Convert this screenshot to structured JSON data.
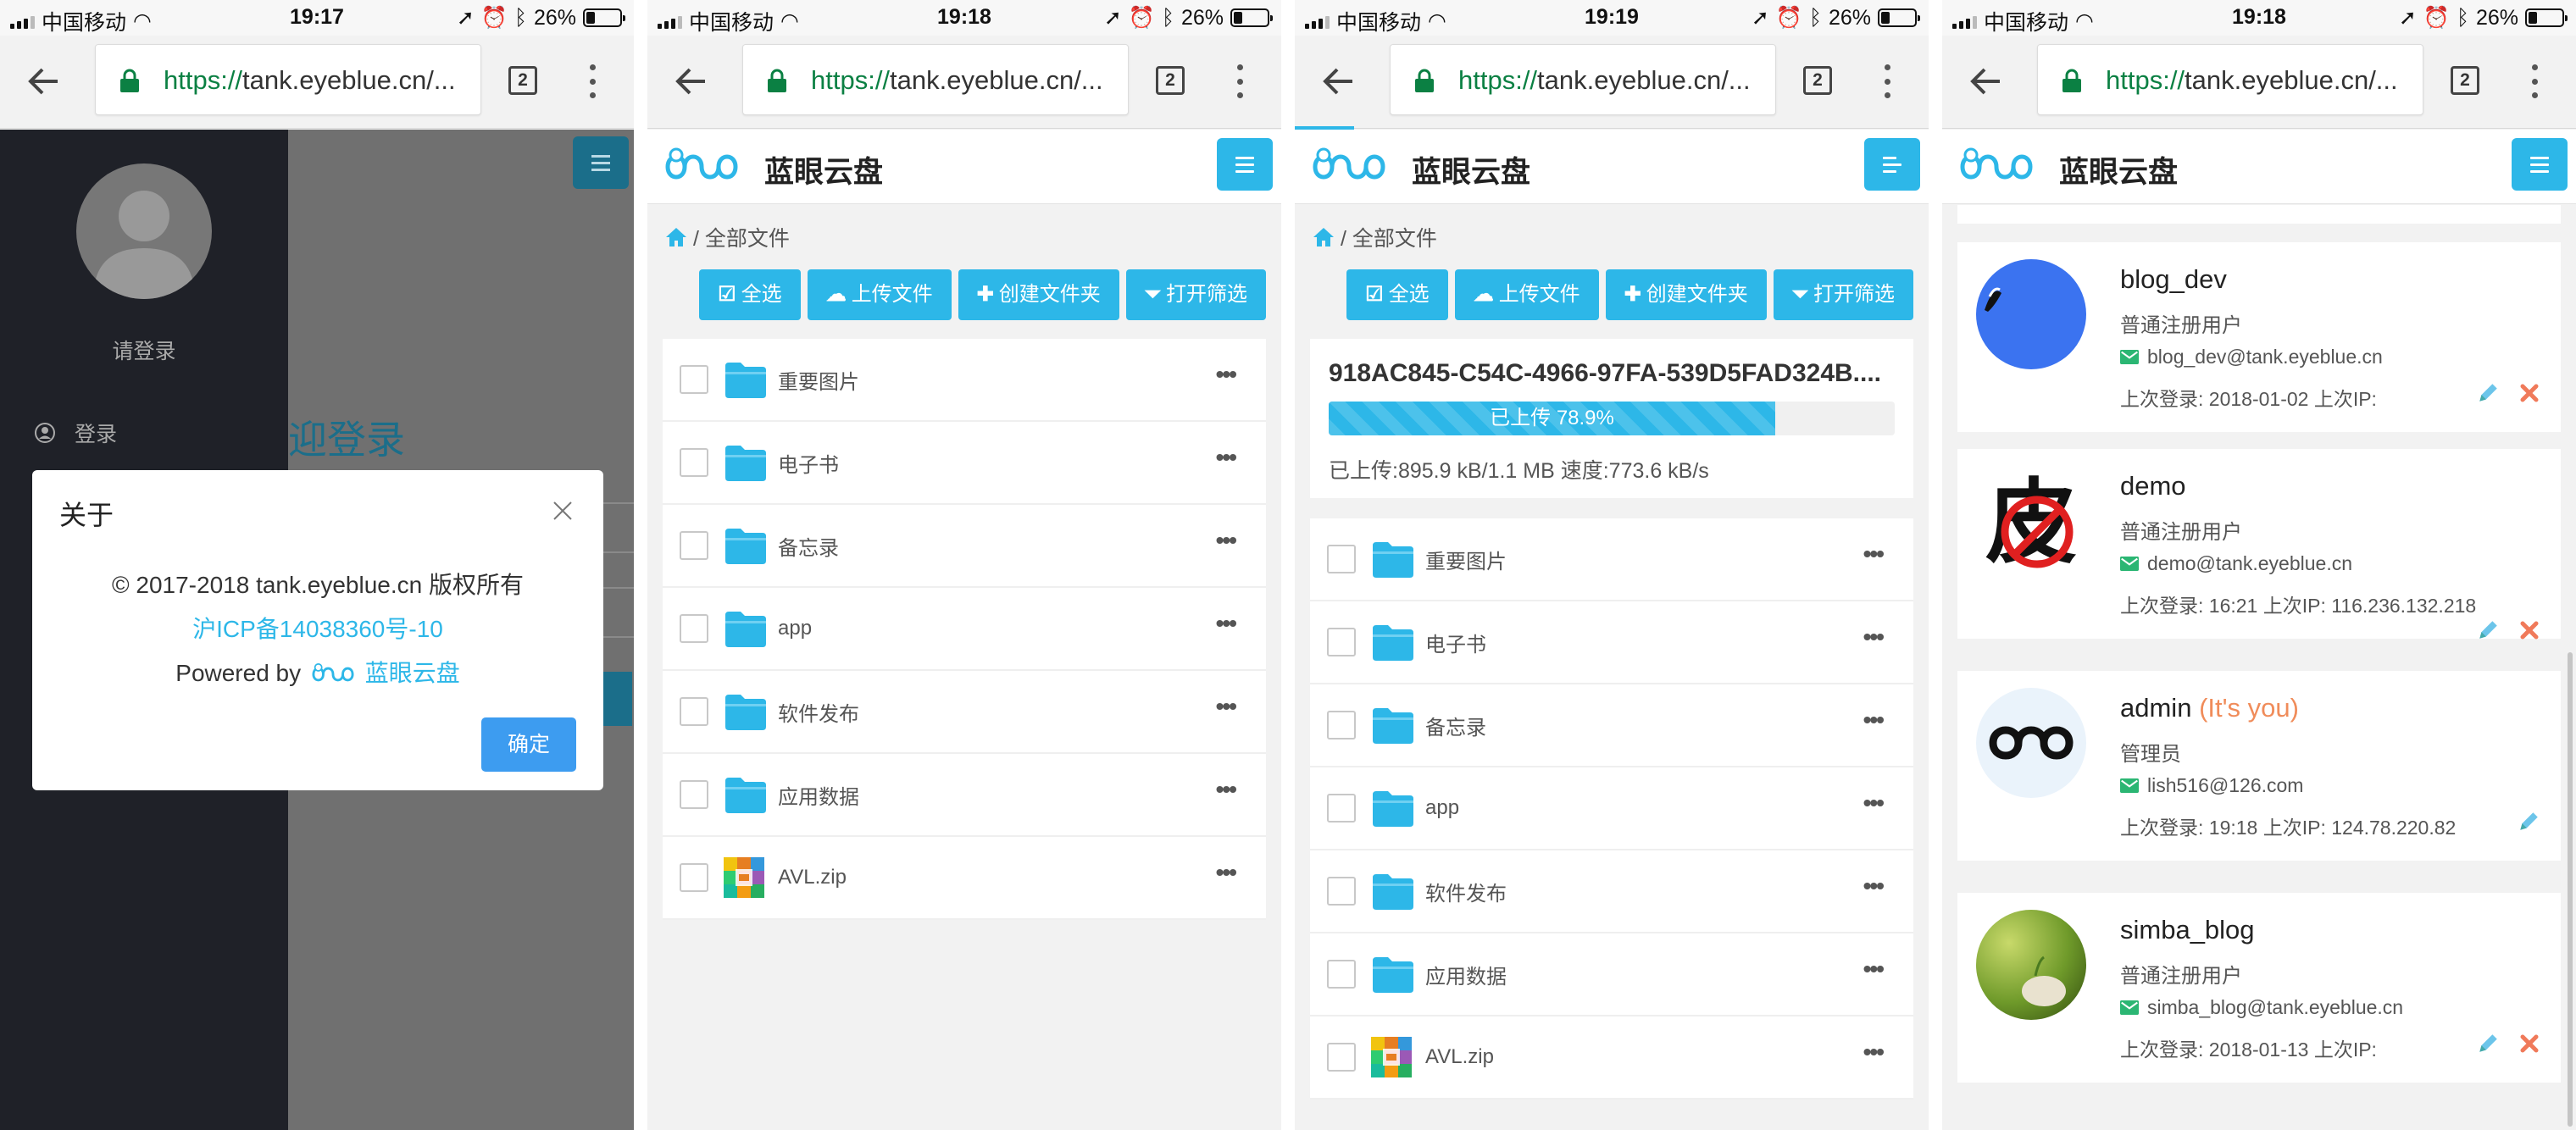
{
  "status_bars": [
    {
      "carrier": "中国移动",
      "time": "19:17",
      "battery": "26%",
      "battery_level": 0.26
    },
    {
      "carrier": "中国移动",
      "time": "19:18",
      "battery": "26%",
      "battery_level": 0.26
    },
    {
      "carrier": "中国移动",
      "time": "19:19",
      "battery": "26%",
      "battery_level": 0.26
    },
    {
      "carrier": "中国移动",
      "time": "19:18",
      "battery": "26%",
      "battery_level": 0.26
    }
  ],
  "browser": {
    "url_scheme": "https://",
    "url_host": "tank.eyeblue.cn/...",
    "tab_count": "2",
    "accent": "#2db7e8"
  },
  "app": {
    "brand": "蓝眼云盘"
  },
  "screen1": {
    "login_hint": "请登录",
    "side_login": "登录",
    "bg_title": "迎登录",
    "modal": {
      "title": "关于",
      "copyright": "© 2017-2018 tank.eyeblue.cn 版权所有",
      "icp": "沪ICP备14038360号-10",
      "powered": "Powered by",
      "powered_brand": "蓝眼云盘",
      "ok": "确定"
    }
  },
  "files": {
    "breadcrumb_sep": "/",
    "breadcrumb": "全部文件",
    "buttons": [
      "全选",
      "上传文件",
      "创建文件夹",
      "打开筛选"
    ],
    "items": [
      {
        "name": "重要图片",
        "type": "folder"
      },
      {
        "name": "电子书",
        "type": "folder"
      },
      {
        "name": "备忘录",
        "type": "folder"
      },
      {
        "name": "app",
        "type": "folder"
      },
      {
        "name": "软件发布",
        "type": "folder"
      },
      {
        "name": "应用数据",
        "type": "folder"
      },
      {
        "name": "AVL.zip",
        "type": "zip"
      }
    ],
    "more": "•••"
  },
  "upload": {
    "filename": "918AC845-C54C-4966-97FA-539D5FAD324B....",
    "progress_label": "已上传 78.9%",
    "progress": 0.789,
    "info": "已上传:895.9 kB/1.1 MB 速度:773.6 kB/s"
  },
  "users": [
    {
      "name": "blog_dev",
      "you": "",
      "role": "普通注册用户",
      "email": "blog_dev@tank.eyeblue.cn",
      "last": "上次登录: 2018-01-02    上次IP:",
      "editable": true,
      "deletable": true
    },
    {
      "name": "demo",
      "you": "",
      "role": "普通注册用户",
      "email": "demo@tank.eyeblue.cn",
      "last": "上次登录: 16:21    上次IP: 116.236.132.218",
      "editable": true,
      "deletable": true
    },
    {
      "name": "admin",
      "you": "(It's you)",
      "role": "管理员",
      "email": "lish516@126.com",
      "last": "上次登录: 19:18    上次IP: 124.78.220.82",
      "editable": true,
      "deletable": false
    },
    {
      "name": "simba_blog",
      "you": "",
      "role": "普通注册用户",
      "email": "simba_blog@tank.eyeblue.cn",
      "last": "上次登录: 2018-01-13    上次IP:",
      "editable": true,
      "deletable": true
    }
  ]
}
